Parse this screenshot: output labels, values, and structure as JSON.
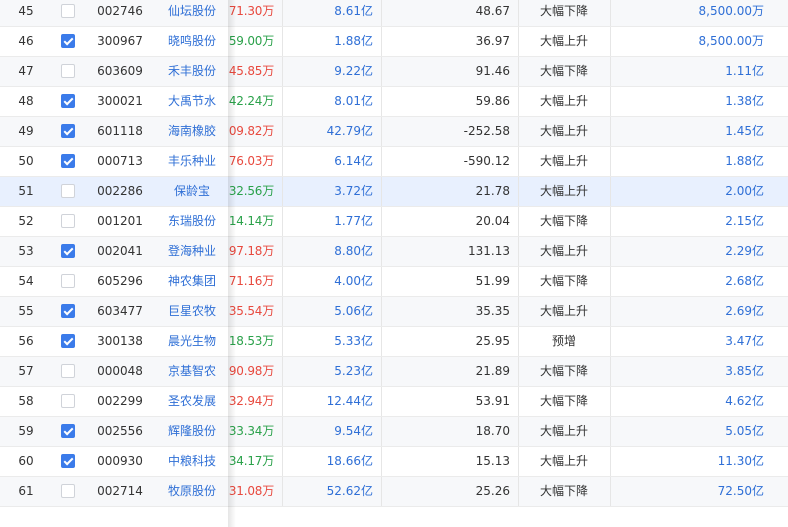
{
  "rows": [
    {
      "index": "45",
      "checked": false,
      "code": "002746",
      "name": "仙坛股份",
      "volume": "71.30万",
      "volume_trend": "up",
      "market_cap": "8.61亿",
      "pe": "48.67",
      "forecast_type": "大幅下降",
      "net_profit": "8,500.00万"
    },
    {
      "index": "46",
      "checked": true,
      "code": "300967",
      "name": "晓鸣股份",
      "volume": "59.00万",
      "volume_trend": "down",
      "market_cap": "1.88亿",
      "pe": "36.97",
      "forecast_type": "大幅上升",
      "net_profit": "8,500.00万"
    },
    {
      "index": "47",
      "checked": false,
      "code": "603609",
      "name": "禾丰股份",
      "volume": "45.85万",
      "volume_trend": "up",
      "market_cap": "9.22亿",
      "pe": "91.46",
      "forecast_type": "大幅下降",
      "net_profit": "1.11亿"
    },
    {
      "index": "48",
      "checked": true,
      "code": "300021",
      "name": "大禹节水",
      "volume": "42.24万",
      "volume_trend": "down",
      "market_cap": "8.01亿",
      "pe": "59.86",
      "forecast_type": "大幅上升",
      "net_profit": "1.38亿"
    },
    {
      "index": "49",
      "checked": true,
      "code": "601118",
      "name": "海南橡胶",
      "volume": "09.82万",
      "volume_trend": "up",
      "market_cap": "42.79亿",
      "pe": "-252.58",
      "forecast_type": "大幅上升",
      "net_profit": "1.45亿"
    },
    {
      "index": "50",
      "checked": true,
      "code": "000713",
      "name": "丰乐种业",
      "volume": "76.03万",
      "volume_trend": "up",
      "market_cap": "6.14亿",
      "pe": "-590.12",
      "forecast_type": "大幅上升",
      "net_profit": "1.88亿"
    },
    {
      "index": "51",
      "checked": false,
      "code": "002286",
      "name": "保龄宝",
      "volume": "32.56万",
      "volume_trend": "down",
      "market_cap": "3.72亿",
      "pe": "21.78",
      "forecast_type": "大幅上升",
      "net_profit": "2.00亿"
    },
    {
      "index": "52",
      "checked": false,
      "code": "001201",
      "name": "东瑞股份",
      "volume": "14.14万",
      "volume_trend": "down",
      "market_cap": "1.77亿",
      "pe": "20.04",
      "forecast_type": "大幅下降",
      "net_profit": "2.15亿"
    },
    {
      "index": "53",
      "checked": true,
      "code": "002041",
      "name": "登海种业",
      "volume": "97.18万",
      "volume_trend": "up",
      "market_cap": "8.80亿",
      "pe": "131.13",
      "forecast_type": "大幅上升",
      "net_profit": "2.29亿"
    },
    {
      "index": "54",
      "checked": false,
      "code": "605296",
      "name": "神农集团",
      "volume": "71.16万",
      "volume_trend": "up",
      "market_cap": "4.00亿",
      "pe": "51.99",
      "forecast_type": "大幅下降",
      "net_profit": "2.68亿"
    },
    {
      "index": "55",
      "checked": true,
      "code": "603477",
      "name": "巨星农牧",
      "volume": "35.54万",
      "volume_trend": "up",
      "market_cap": "5.06亿",
      "pe": "35.35",
      "forecast_type": "大幅上升",
      "net_profit": "2.69亿"
    },
    {
      "index": "56",
      "checked": true,
      "code": "300138",
      "name": "晨光生物",
      "volume": "18.53万",
      "volume_trend": "down",
      "market_cap": "5.33亿",
      "pe": "25.95",
      "forecast_type": "预增",
      "net_profit": "3.47亿"
    },
    {
      "index": "57",
      "checked": false,
      "code": "000048",
      "name": "京基智农",
      "volume": "90.98万",
      "volume_trend": "up",
      "market_cap": "5.23亿",
      "pe": "21.89",
      "forecast_type": "大幅下降",
      "net_profit": "3.85亿"
    },
    {
      "index": "58",
      "checked": false,
      "code": "002299",
      "name": "圣农发展",
      "volume": "32.94万",
      "volume_trend": "up",
      "market_cap": "12.44亿",
      "pe": "53.91",
      "forecast_type": "大幅下降",
      "net_profit": "4.62亿"
    },
    {
      "index": "59",
      "checked": true,
      "code": "002556",
      "name": "辉隆股份",
      "volume": "33.34万",
      "volume_trend": "down",
      "market_cap": "9.54亿",
      "pe": "18.70",
      "forecast_type": "大幅上升",
      "net_profit": "5.05亿"
    },
    {
      "index": "60",
      "checked": true,
      "code": "000930",
      "name": "中粮科技",
      "volume": "34.17万",
      "volume_trend": "down",
      "market_cap": "18.66亿",
      "pe": "15.13",
      "forecast_type": "大幅上升",
      "net_profit": "11.30亿"
    },
    {
      "index": "61",
      "checked": false,
      "code": "002714",
      "name": "牧原股份",
      "volume": "31.08万",
      "volume_trend": "up",
      "market_cap": "52.62亿",
      "pe": "25.26",
      "forecast_type": "大幅下降",
      "net_profit": "72.50亿"
    }
  ],
  "selected_row": "51",
  "colors": {
    "up": "#e8493e",
    "down": "#2aa14a",
    "link": "#2f6fd6",
    "checkbox": "#3b7bea",
    "row_selected": "#e8f0fe"
  }
}
